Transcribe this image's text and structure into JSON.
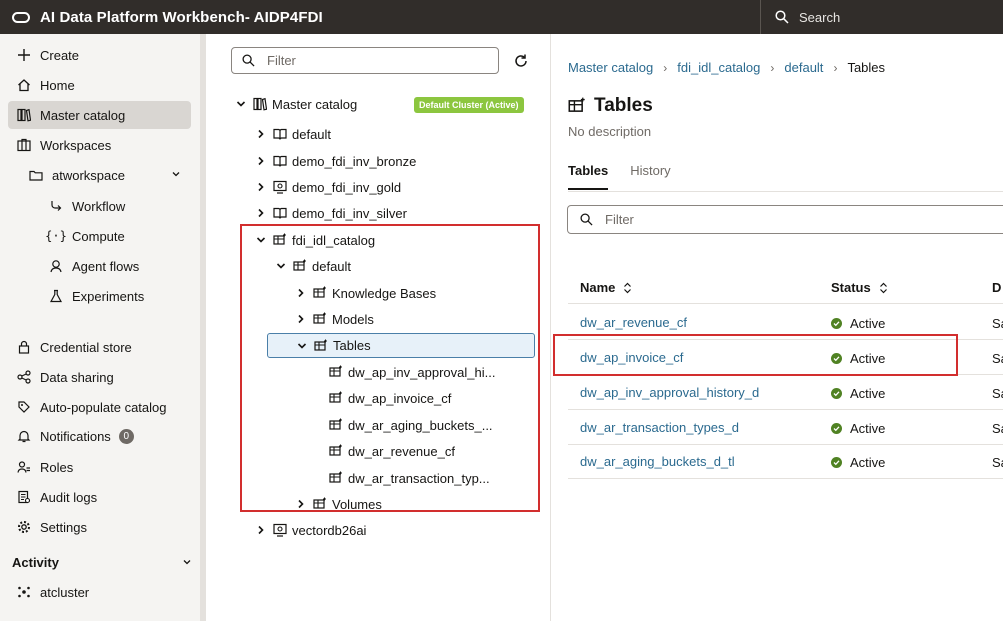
{
  "header": {
    "title": "AI Data Platform Workbench- AIDP4FDI",
    "search_placeholder": "Search"
  },
  "sidebar": {
    "items": [
      {
        "label": "Create",
        "icon": "plus-icon"
      },
      {
        "label": "Home",
        "icon": "home-icon"
      },
      {
        "label": "Master catalog",
        "icon": "catalog-icon",
        "active": true
      },
      {
        "label": "Workspaces",
        "icon": "workspaces-icon"
      },
      {
        "label": "atworkspace",
        "icon": "folder-icon"
      },
      {
        "label": "Workflow",
        "icon": "workflow-icon"
      },
      {
        "label": "Compute",
        "icon": "compute-icon"
      },
      {
        "label": "Agent flows",
        "icon": "agent-icon"
      },
      {
        "label": "Experiments",
        "icon": "flask-icon"
      },
      {
        "label": "Credential store",
        "icon": "lock-icon"
      },
      {
        "label": "Data sharing",
        "icon": "share-icon"
      },
      {
        "label": "Auto-populate catalog",
        "icon": "auto-populate-icon"
      },
      {
        "label": "Notifications",
        "icon": "bell-icon",
        "badge": "0"
      },
      {
        "label": "Roles",
        "icon": "roles-icon"
      },
      {
        "label": "Audit logs",
        "icon": "audit-icon"
      },
      {
        "label": "Settings",
        "icon": "gear-icon"
      }
    ],
    "activity_header": "Activity",
    "activity_items": [
      {
        "label": "atcluster",
        "icon": "cluster-icon"
      }
    ]
  },
  "tree": {
    "filter_placeholder": "Filter",
    "root": {
      "label": "Master catalog",
      "badge": "Default Cluster (Active)"
    },
    "nodes": [
      {
        "label": "default"
      },
      {
        "label": "demo_fdi_inv_bronze"
      },
      {
        "label": "demo_fdi_inv_gold"
      },
      {
        "label": "demo_fdi_inv_silver"
      },
      {
        "label": "fdi_idl_catalog"
      },
      {
        "label": "default"
      },
      {
        "label": "Knowledge Bases"
      },
      {
        "label": "Models"
      },
      {
        "label": "Tables"
      },
      {
        "label": "dw_ap_inv_approval_hi..."
      },
      {
        "label": "dw_ap_invoice_cf"
      },
      {
        "label": "dw_ar_aging_buckets_..."
      },
      {
        "label": "dw_ar_revenue_cf"
      },
      {
        "label": "dw_ar_transaction_typ..."
      },
      {
        "label": "Volumes"
      },
      {
        "label": "vectordb26ai"
      }
    ]
  },
  "main": {
    "breadcrumb": [
      "Master catalog",
      "fdi_idl_catalog",
      "default",
      "Tables"
    ],
    "title": "Tables",
    "description": "No description",
    "tabs": [
      "Tables",
      "History"
    ],
    "filter_placeholder": "Filter",
    "columns": [
      "Name",
      "Status",
      "D"
    ],
    "rows": [
      {
        "name": "dw_ar_revenue_cf",
        "status": "Active",
        "extra": "Sa"
      },
      {
        "name": "dw_ap_invoice_cf",
        "status": "Active",
        "extra": "Sa"
      },
      {
        "name": "dw_ap_inv_approval_history_d",
        "status": "Active",
        "extra": "Sa"
      },
      {
        "name": "dw_ar_transaction_types_d",
        "status": "Active",
        "extra": "Sa"
      },
      {
        "name": "dw_ar_aging_buckets_d_tl",
        "status": "Active",
        "extra": "Sa"
      }
    ]
  },
  "colors": {
    "header_bg": "#312d2a",
    "link": "#2b6a8f",
    "active_green": "#508223",
    "cluster_badge": "#8cc63f",
    "highlight_red": "#d22e2e"
  }
}
